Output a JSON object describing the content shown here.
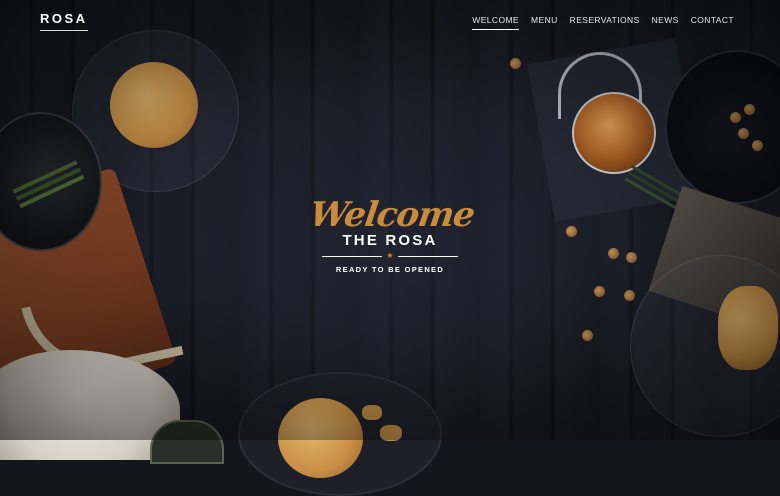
{
  "header": {
    "logo": "ROSA",
    "nav": [
      {
        "label": "WELCOME",
        "active": true
      },
      {
        "label": "MENU",
        "active": false
      },
      {
        "label": "RESERVATIONS",
        "active": false
      },
      {
        "label": "NEWS",
        "active": false
      },
      {
        "label": "CONTACT",
        "active": false
      }
    ]
  },
  "hero": {
    "script_title": "Welcome",
    "title": "THE ROSA",
    "divider_icon": "star-icon",
    "subtitle": "READY TO BE OPENED"
  },
  "colors": {
    "accent": "#c98b3e",
    "background": "#14161d",
    "text": "#ffffff"
  }
}
